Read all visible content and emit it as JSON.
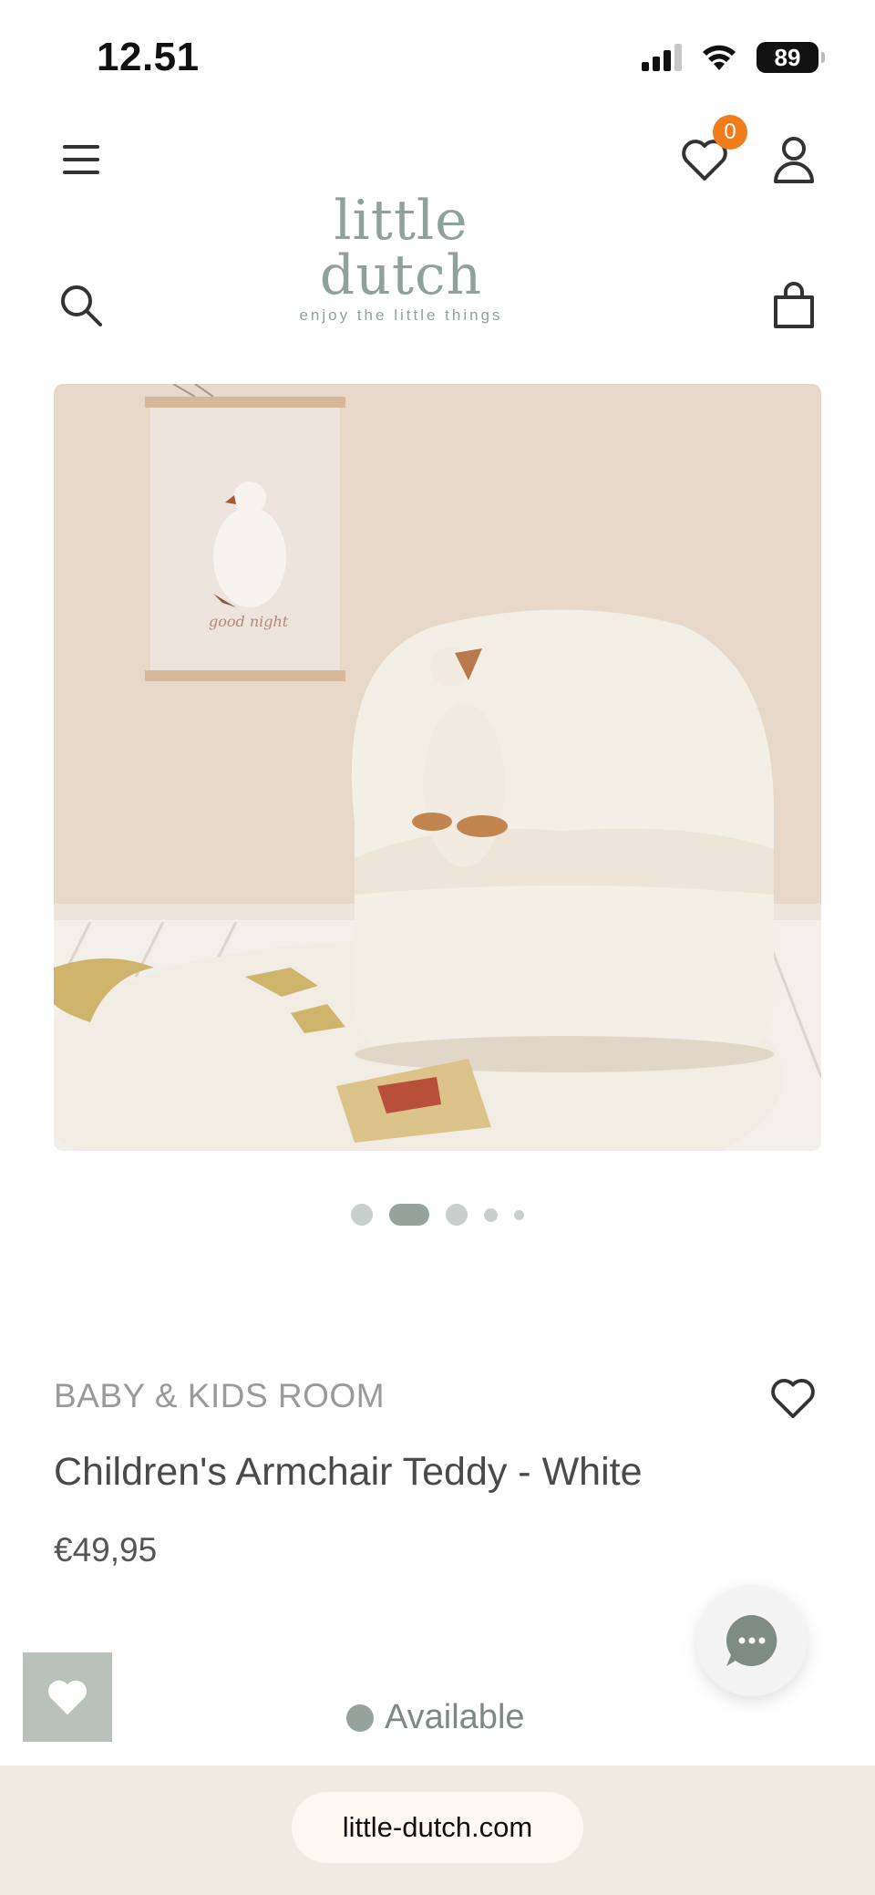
{
  "status_bar": {
    "time": "12.51",
    "battery": "89"
  },
  "header": {
    "wishlist_count": "0",
    "logo": {
      "name": "little dutch",
      "tagline": "enjoy the little things"
    },
    "icons": [
      "menu-icon",
      "heart-icon",
      "user-icon",
      "search-icon",
      "shopping-bag-icon"
    ]
  },
  "gallery": {
    "active_index": 1,
    "total": 5
  },
  "product": {
    "category": "BABY & KIDS ROOM",
    "title": "Children's Armchair Teddy - White",
    "price": "€49,95",
    "availability": "Available"
  },
  "colors": {
    "brand": "#8fa19b",
    "badge": "#f07d1a",
    "available": "#95a39d"
  },
  "browser": {
    "url": "little-dutch.com"
  }
}
